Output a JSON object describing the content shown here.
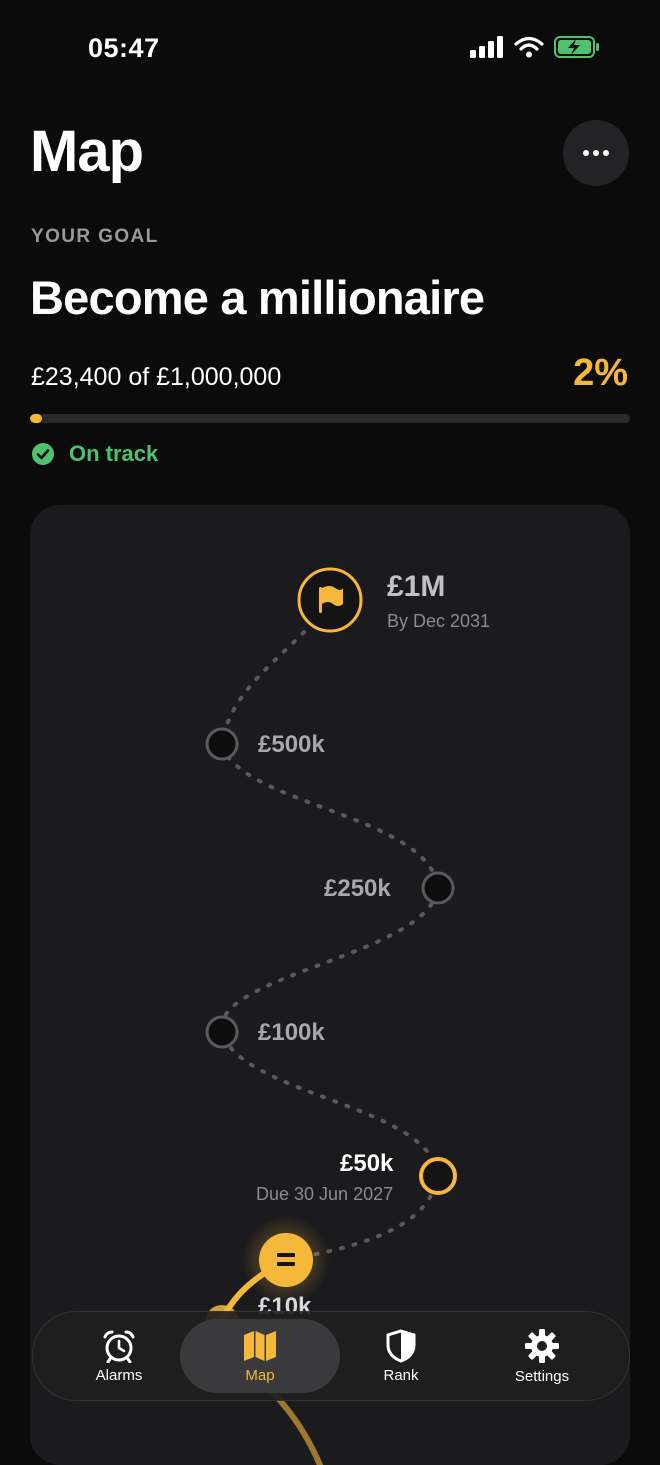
{
  "status_bar": {
    "time": "05:47"
  },
  "header": {
    "title": "Map"
  },
  "goal": {
    "label": "YOUR GOAL",
    "title": "Become a millionaire",
    "progress_text": "£23,400 of £1,000,000",
    "percent_text": "2%",
    "progress_fraction": 0.02,
    "status": "On track"
  },
  "milestones": {
    "m1": {
      "label": "£1M",
      "sub": "By Dec 2031"
    },
    "m500": {
      "label": "£500k"
    },
    "m250": {
      "label": "£250k"
    },
    "m100": {
      "label": "£100k"
    },
    "m50": {
      "label": "£50k",
      "sub": "Due 30 Jun 2027"
    },
    "m10": {
      "label": "£10k"
    }
  },
  "tabs": [
    {
      "label": "Alarms",
      "icon": "alarm-clock-icon"
    },
    {
      "label": "Map",
      "icon": "map-icon",
      "active": true
    },
    {
      "label": "Rank",
      "icon": "shield-icon"
    },
    {
      "label": "Settings",
      "icon": "gear-icon"
    }
  ],
  "colors": {
    "accent": "#f6b83a",
    "success": "#4fc26f",
    "background": "#0b0b0c",
    "card": "#1b1b1d"
  }
}
